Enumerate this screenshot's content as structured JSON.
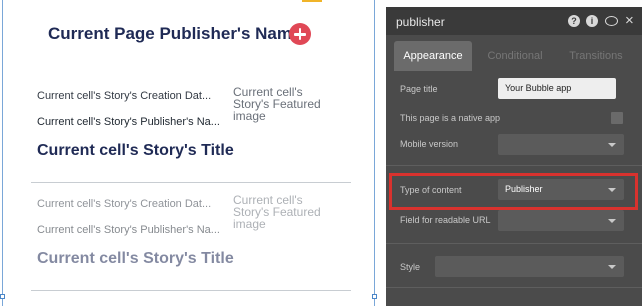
{
  "canvas": {
    "header_title": "Current Page Publisher's Name",
    "cells": [
      {
        "date": "Current cell's Story's Creation Dat...",
        "publisher": "Current cell's Story's Publisher's Na...",
        "title": "Current cell's Story's Title",
        "image": "Current cell's Story's Featured image"
      },
      {
        "date": "Current cell's Story's Creation Dat...",
        "publisher": "Current cell's Story's Publisher's Na...",
        "title": "Current cell's Story's Title",
        "image": "Current cell's Story's Featured image"
      }
    ]
  },
  "panel": {
    "title": "publisher",
    "header_icons": [
      "help-icon",
      "info-icon",
      "comment-icon",
      "close-icon"
    ],
    "tabs": [
      {
        "label": "Appearance",
        "active": true
      },
      {
        "label": "Conditional",
        "active": false
      },
      {
        "label": "Transitions",
        "active": false
      }
    ],
    "fields": {
      "page_title": {
        "label": "Page title",
        "value": "Your Bubble app"
      },
      "native_app": {
        "label": "This page is a native app",
        "checked": false
      },
      "mobile_version": {
        "label": "Mobile version",
        "value": ""
      },
      "type_of_content": {
        "label": "Type of content",
        "value": "Publisher"
      },
      "readable_url": {
        "label": "Field for readable URL",
        "value": ""
      },
      "style": {
        "label": "Style",
        "value": ""
      }
    }
  },
  "colors": {
    "title_navy": "#1f2a55",
    "accent_red": "#e04856",
    "highlight_red": "#d9322e",
    "panel_bg": "#4b4b4b"
  }
}
